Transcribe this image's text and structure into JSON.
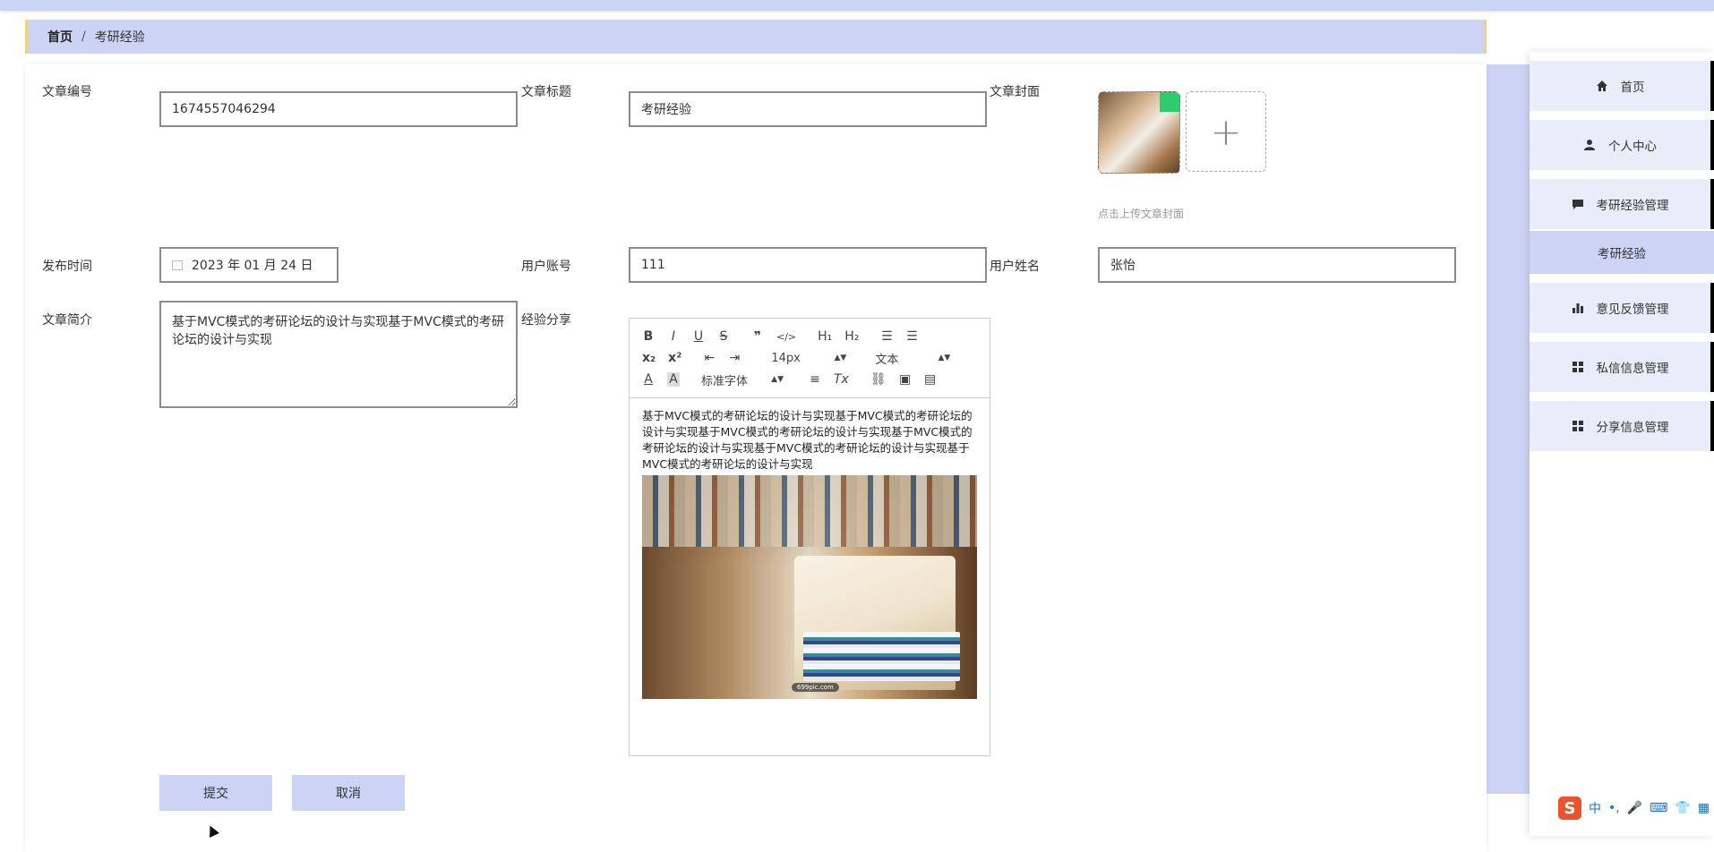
{
  "breadcrumb": {
    "home": "首页",
    "separator": "/",
    "current": "考研经验"
  },
  "form": {
    "article_no_label": "文章编号",
    "article_no_value": "1674557046294",
    "title_label": "文章标题",
    "title_value": "考研经验",
    "cover_label": "文章封面",
    "cover_hint": "点击上传文章封面",
    "publish_time_label": "发布时间",
    "publish_time_value": "2023 年 01 月 24 日",
    "account_label": "用户账号",
    "account_value": "111",
    "username_label": "用户姓名",
    "username_value": "张怡",
    "intro_label": "文章简介",
    "intro_value": "基于MVC模式的考研论坛的设计与实现基于MVC模式的考研论坛的设计与实现",
    "share_label": "经验分享"
  },
  "editor": {
    "font_size": "14px",
    "block_type": "文本",
    "font_family": "标准字体",
    "content_text": "基于MVC模式的考研论坛的设计与实现基于MVC模式的考研论坛的设计与实现基于MVC模式的考研论坛的设计与实现基于MVC模式的考研论坛的设计与实现基于MVC模式的考研论坛的设计与实现基于MVC模式的考研论坛的设计与实现",
    "image_watermark": "699pic.com"
  },
  "buttons": {
    "submit": "提交",
    "cancel": "取消"
  },
  "sidebar": {
    "items": [
      {
        "label": "首页",
        "icon": "home-icon"
      },
      {
        "label": "个人中心",
        "icon": "user-icon"
      },
      {
        "label": "考研经验管理",
        "icon": "chat-icon"
      },
      {
        "label": "意见反馈管理",
        "icon": "bar-chart-icon"
      },
      {
        "label": "私信信息管理",
        "icon": "grid-icon"
      },
      {
        "label": "分享信息管理",
        "icon": "grid-icon"
      }
    ],
    "sub_item": "考研经验"
  },
  "ime": {
    "logo": "S",
    "mode": "中"
  },
  "colors": {
    "accent": "#cdd3f4",
    "breadcrumb_border": "#f3d27a",
    "sidebar_item_bg": "#e9ecf9"
  }
}
